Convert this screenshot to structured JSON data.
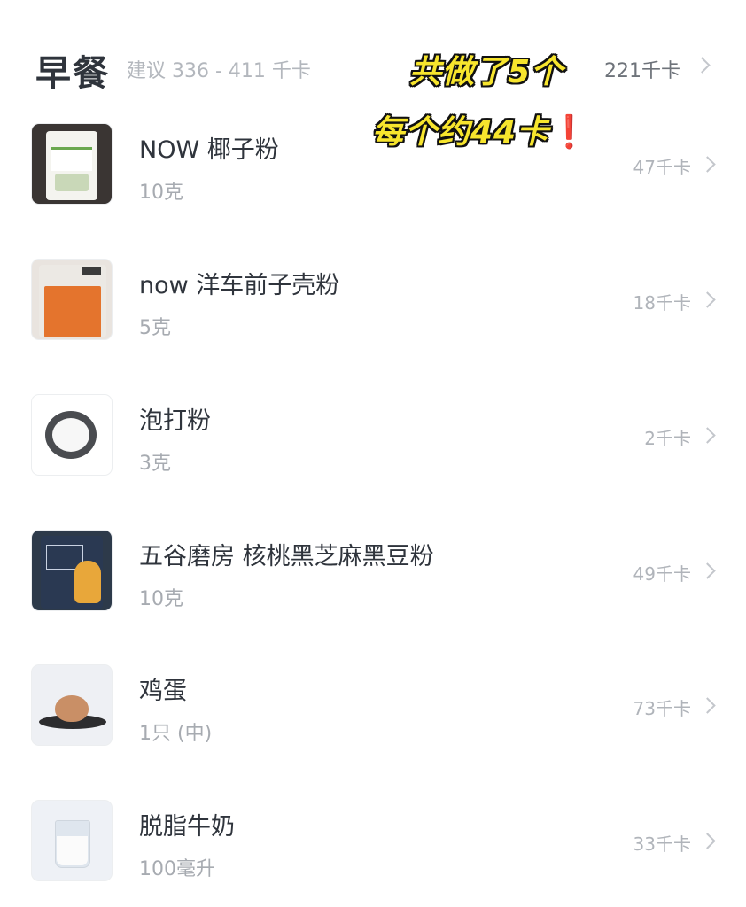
{
  "header": {
    "meal_title": "早餐",
    "suggestion": "建议 336 - 411 千卡",
    "total_kcal": "221千卡"
  },
  "annotation": {
    "line1": "共做了5个",
    "line2": "每个约44卡",
    "mark": "❗"
  },
  "items": [
    {
      "name": "NOW 椰子粉",
      "amount": "10克",
      "kcal": "47千卡",
      "thumb_icon": "coconut-flour-bag"
    },
    {
      "name": "now 洋车前子壳粉",
      "amount": "5克",
      "kcal": "18千卡",
      "thumb_icon": "psyllium-powder-bag"
    },
    {
      "name": "泡打粉",
      "amount": "3克",
      "kcal": "2千卡",
      "thumb_icon": "baking-powder-dish"
    },
    {
      "name": "五谷磨房 核桃黑芝麻黑豆粉",
      "amount": "10克",
      "kcal": "49千卡",
      "thumb_icon": "grain-powder-bag"
    },
    {
      "name": "鸡蛋",
      "amount": "1只 (中)",
      "kcal": "73千卡",
      "thumb_icon": "egg-on-plate"
    },
    {
      "name": "脱脂牛奶",
      "amount": "100毫升",
      "kcal": "33千卡",
      "thumb_icon": "milk-glass"
    }
  ]
}
